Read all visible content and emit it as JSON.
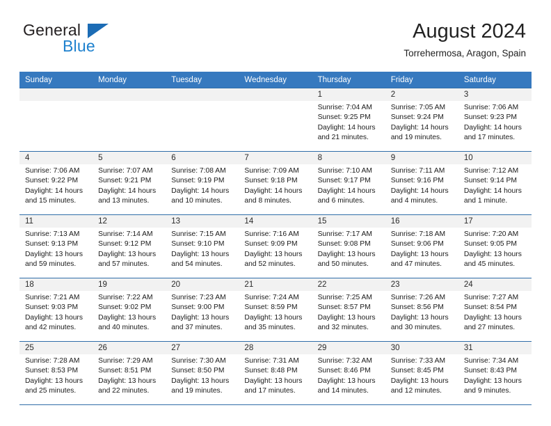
{
  "brand": {
    "name_top": "General",
    "name_bottom": "Blue",
    "accent_color": "#1e81ce",
    "triangle_color": "#1c6cb5"
  },
  "header": {
    "title": "August 2024",
    "subtitle": "Torrehermosa, Aragon, Spain"
  },
  "theme": {
    "header_row_bg": "#3679bf",
    "row_divider": "#2f6da8",
    "daynum_bg": "#f2f2f2"
  },
  "weekday_headers": [
    "Sunday",
    "Monday",
    "Tuesday",
    "Wednesday",
    "Thursday",
    "Friday",
    "Saturday"
  ],
  "labels": {
    "sunrise_prefix": "Sunrise:",
    "sunset_prefix": "Sunset:",
    "daylight_prefix": "Daylight:"
  },
  "weeks": [
    [
      {
        "day": "",
        "empty": true,
        "sunrise": "",
        "sunset": "",
        "daylight_line1": "",
        "daylight_line2": ""
      },
      {
        "day": "",
        "empty": true,
        "sunrise": "",
        "sunset": "",
        "daylight_line1": "",
        "daylight_line2": ""
      },
      {
        "day": "",
        "empty": true,
        "sunrise": "",
        "sunset": "",
        "daylight_line1": "",
        "daylight_line2": ""
      },
      {
        "day": "",
        "empty": true,
        "sunrise": "",
        "sunset": "",
        "daylight_line1": "",
        "daylight_line2": ""
      },
      {
        "day": "1",
        "sunrise": "Sunrise: 7:04 AM",
        "sunset": "Sunset: 9:25 PM",
        "daylight_line1": "Daylight: 14 hours",
        "daylight_line2": "and 21 minutes."
      },
      {
        "day": "2",
        "sunrise": "Sunrise: 7:05 AM",
        "sunset": "Sunset: 9:24 PM",
        "daylight_line1": "Daylight: 14 hours",
        "daylight_line2": "and 19 minutes."
      },
      {
        "day": "3",
        "sunrise": "Sunrise: 7:06 AM",
        "sunset": "Sunset: 9:23 PM",
        "daylight_line1": "Daylight: 14 hours",
        "daylight_line2": "and 17 minutes."
      }
    ],
    [
      {
        "day": "4",
        "sunrise": "Sunrise: 7:06 AM",
        "sunset": "Sunset: 9:22 PM",
        "daylight_line1": "Daylight: 14 hours",
        "daylight_line2": "and 15 minutes."
      },
      {
        "day": "5",
        "sunrise": "Sunrise: 7:07 AM",
        "sunset": "Sunset: 9:21 PM",
        "daylight_line1": "Daylight: 14 hours",
        "daylight_line2": "and 13 minutes."
      },
      {
        "day": "6",
        "sunrise": "Sunrise: 7:08 AM",
        "sunset": "Sunset: 9:19 PM",
        "daylight_line1": "Daylight: 14 hours",
        "daylight_line2": "and 10 minutes."
      },
      {
        "day": "7",
        "sunrise": "Sunrise: 7:09 AM",
        "sunset": "Sunset: 9:18 PM",
        "daylight_line1": "Daylight: 14 hours",
        "daylight_line2": "and 8 minutes."
      },
      {
        "day": "8",
        "sunrise": "Sunrise: 7:10 AM",
        "sunset": "Sunset: 9:17 PM",
        "daylight_line1": "Daylight: 14 hours",
        "daylight_line2": "and 6 minutes."
      },
      {
        "day": "9",
        "sunrise": "Sunrise: 7:11 AM",
        "sunset": "Sunset: 9:16 PM",
        "daylight_line1": "Daylight: 14 hours",
        "daylight_line2": "and 4 minutes."
      },
      {
        "day": "10",
        "sunrise": "Sunrise: 7:12 AM",
        "sunset": "Sunset: 9:14 PM",
        "daylight_line1": "Daylight: 14 hours",
        "daylight_line2": "and 1 minute."
      }
    ],
    [
      {
        "day": "11",
        "sunrise": "Sunrise: 7:13 AM",
        "sunset": "Sunset: 9:13 PM",
        "daylight_line1": "Daylight: 13 hours",
        "daylight_line2": "and 59 minutes."
      },
      {
        "day": "12",
        "sunrise": "Sunrise: 7:14 AM",
        "sunset": "Sunset: 9:12 PM",
        "daylight_line1": "Daylight: 13 hours",
        "daylight_line2": "and 57 minutes."
      },
      {
        "day": "13",
        "sunrise": "Sunrise: 7:15 AM",
        "sunset": "Sunset: 9:10 PM",
        "daylight_line1": "Daylight: 13 hours",
        "daylight_line2": "and 54 minutes."
      },
      {
        "day": "14",
        "sunrise": "Sunrise: 7:16 AM",
        "sunset": "Sunset: 9:09 PM",
        "daylight_line1": "Daylight: 13 hours",
        "daylight_line2": "and 52 minutes."
      },
      {
        "day": "15",
        "sunrise": "Sunrise: 7:17 AM",
        "sunset": "Sunset: 9:08 PM",
        "daylight_line1": "Daylight: 13 hours",
        "daylight_line2": "and 50 minutes."
      },
      {
        "day": "16",
        "sunrise": "Sunrise: 7:18 AM",
        "sunset": "Sunset: 9:06 PM",
        "daylight_line1": "Daylight: 13 hours",
        "daylight_line2": "and 47 minutes."
      },
      {
        "day": "17",
        "sunrise": "Sunrise: 7:20 AM",
        "sunset": "Sunset: 9:05 PM",
        "daylight_line1": "Daylight: 13 hours",
        "daylight_line2": "and 45 minutes."
      }
    ],
    [
      {
        "day": "18",
        "sunrise": "Sunrise: 7:21 AM",
        "sunset": "Sunset: 9:03 PM",
        "daylight_line1": "Daylight: 13 hours",
        "daylight_line2": "and 42 minutes."
      },
      {
        "day": "19",
        "sunrise": "Sunrise: 7:22 AM",
        "sunset": "Sunset: 9:02 PM",
        "daylight_line1": "Daylight: 13 hours",
        "daylight_line2": "and 40 minutes."
      },
      {
        "day": "20",
        "sunrise": "Sunrise: 7:23 AM",
        "sunset": "Sunset: 9:00 PM",
        "daylight_line1": "Daylight: 13 hours",
        "daylight_line2": "and 37 minutes."
      },
      {
        "day": "21",
        "sunrise": "Sunrise: 7:24 AM",
        "sunset": "Sunset: 8:59 PM",
        "daylight_line1": "Daylight: 13 hours",
        "daylight_line2": "and 35 minutes."
      },
      {
        "day": "22",
        "sunrise": "Sunrise: 7:25 AM",
        "sunset": "Sunset: 8:57 PM",
        "daylight_line1": "Daylight: 13 hours",
        "daylight_line2": "and 32 minutes."
      },
      {
        "day": "23",
        "sunrise": "Sunrise: 7:26 AM",
        "sunset": "Sunset: 8:56 PM",
        "daylight_line1": "Daylight: 13 hours",
        "daylight_line2": "and 30 minutes."
      },
      {
        "day": "24",
        "sunrise": "Sunrise: 7:27 AM",
        "sunset": "Sunset: 8:54 PM",
        "daylight_line1": "Daylight: 13 hours",
        "daylight_line2": "and 27 minutes."
      }
    ],
    [
      {
        "day": "25",
        "sunrise": "Sunrise: 7:28 AM",
        "sunset": "Sunset: 8:53 PM",
        "daylight_line1": "Daylight: 13 hours",
        "daylight_line2": "and 25 minutes."
      },
      {
        "day": "26",
        "sunrise": "Sunrise: 7:29 AM",
        "sunset": "Sunset: 8:51 PM",
        "daylight_line1": "Daylight: 13 hours",
        "daylight_line2": "and 22 minutes."
      },
      {
        "day": "27",
        "sunrise": "Sunrise: 7:30 AM",
        "sunset": "Sunset: 8:50 PM",
        "daylight_line1": "Daylight: 13 hours",
        "daylight_line2": "and 19 minutes."
      },
      {
        "day": "28",
        "sunrise": "Sunrise: 7:31 AM",
        "sunset": "Sunset: 8:48 PM",
        "daylight_line1": "Daylight: 13 hours",
        "daylight_line2": "and 17 minutes."
      },
      {
        "day": "29",
        "sunrise": "Sunrise: 7:32 AM",
        "sunset": "Sunset: 8:46 PM",
        "daylight_line1": "Daylight: 13 hours",
        "daylight_line2": "and 14 minutes."
      },
      {
        "day": "30",
        "sunrise": "Sunrise: 7:33 AM",
        "sunset": "Sunset: 8:45 PM",
        "daylight_line1": "Daylight: 13 hours",
        "daylight_line2": "and 12 minutes."
      },
      {
        "day": "31",
        "sunrise": "Sunrise: 7:34 AM",
        "sunset": "Sunset: 8:43 PM",
        "daylight_line1": "Daylight: 13 hours",
        "daylight_line2": "and 9 minutes."
      }
    ]
  ]
}
